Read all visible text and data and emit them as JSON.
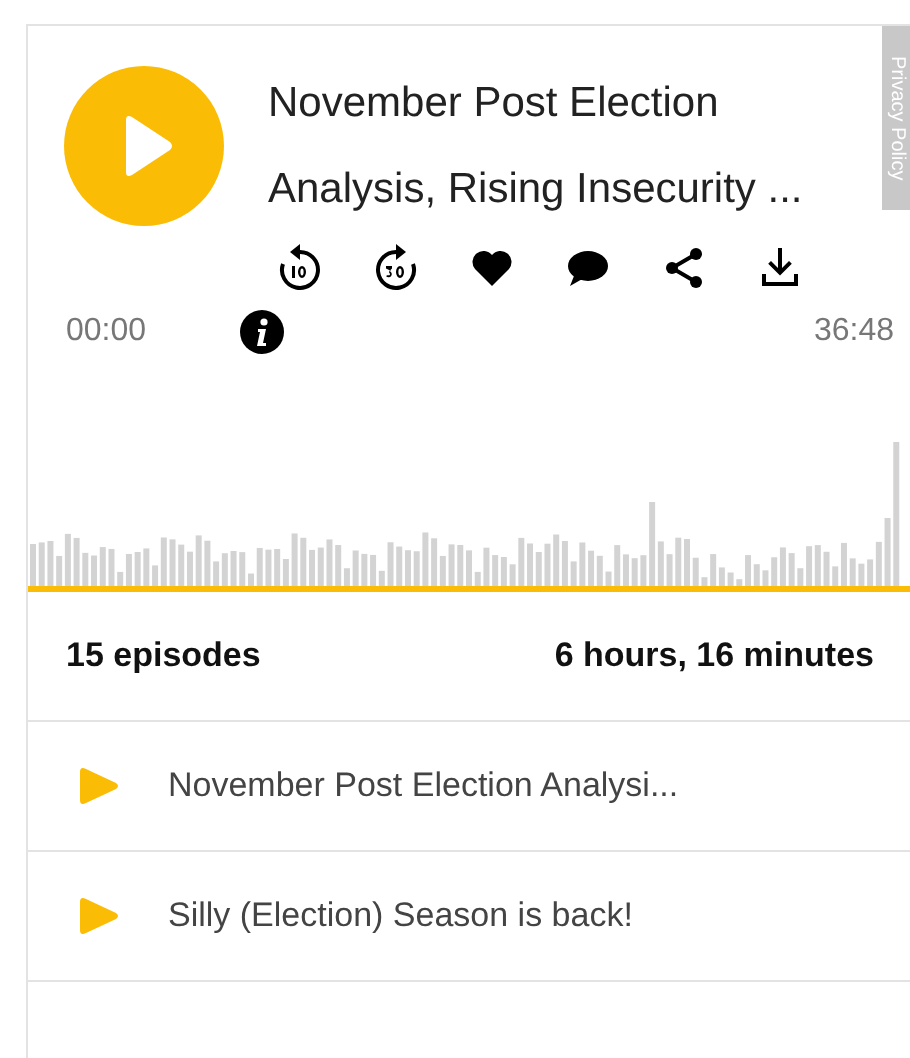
{
  "player": {
    "title_lines": [
      "November Post Election",
      "Analysis, Rising Insecurity ..."
    ],
    "elapsed": "00:00",
    "duration": "36:48"
  },
  "privacy_tab": "Privacy Policy",
  "summary": {
    "episodes": "15 episodes",
    "length": "6 hours, 16 minutes"
  },
  "episodes": [
    {
      "title": "November Post Election Analysi..."
    },
    {
      "title": "Silly (Election) Season is back!"
    }
  ]
}
